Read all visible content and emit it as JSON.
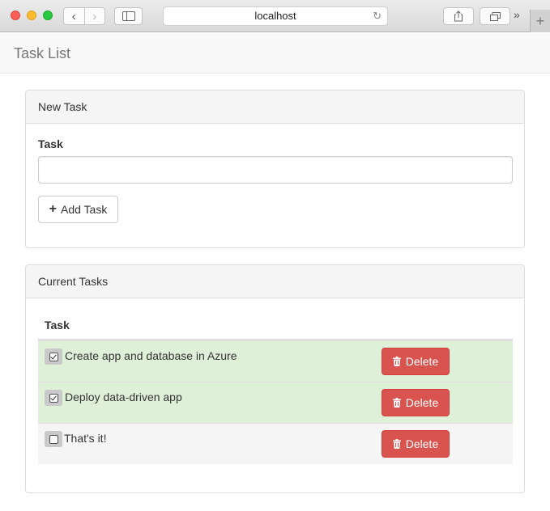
{
  "browser": {
    "url": "localhost"
  },
  "navbar": {
    "brand": "Task List"
  },
  "new_task": {
    "heading": "New Task",
    "field_label": "Task",
    "input_value": "",
    "add_button": "Add Task"
  },
  "current_tasks": {
    "heading": "Current Tasks",
    "column_header": "Task",
    "delete_label": "Delete",
    "rows": [
      {
        "text": "Create app and database in Azure",
        "done": true
      },
      {
        "text": "Deploy data-driven app",
        "done": true
      },
      {
        "text": "That's it!",
        "done": false
      }
    ]
  },
  "colors": {
    "success_row": "#dff0d8",
    "danger": "#d9534f"
  },
  "icons": [
    "back-icon",
    "forward-icon",
    "sidebar-icon",
    "reload-icon",
    "share-icon",
    "tabs-icon",
    "plus-icon",
    "trash-icon",
    "checkbox-icon"
  ]
}
